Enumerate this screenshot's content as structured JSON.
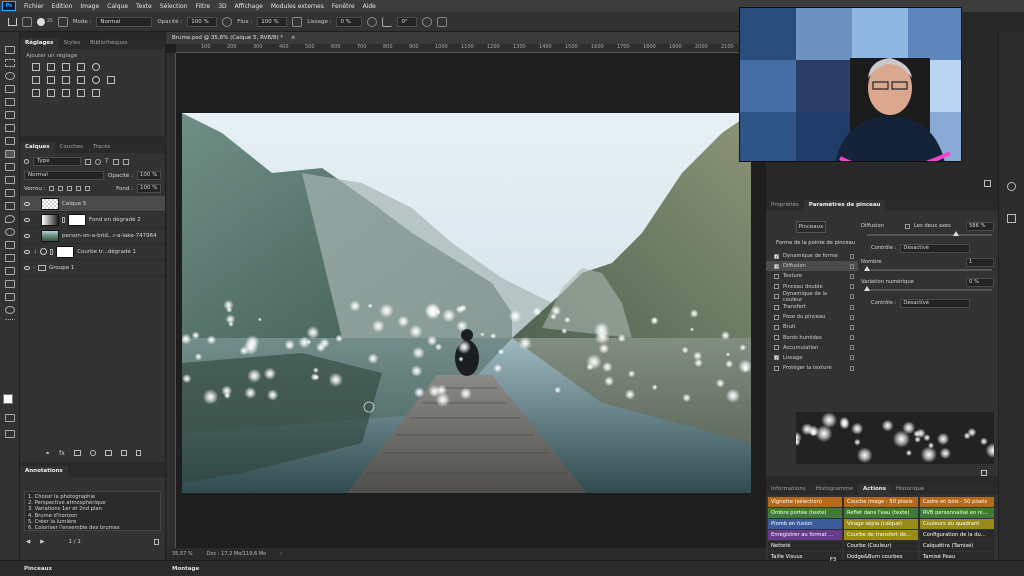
{
  "menubar": {
    "logo": "Ps",
    "items": [
      "Fichier",
      "Edition",
      "Image",
      "Calque",
      "Texte",
      "Sélection",
      "Filtre",
      "3D",
      "Affichage",
      "Modules externes",
      "Fenêtre",
      "Aide"
    ]
  },
  "options": {
    "size": "25",
    "mode_label": "Mode :",
    "mode_value": "Normal",
    "opacity_label": "Opacité :",
    "opacity_value": "100 %",
    "flow_label": "Flux :",
    "flow_value": "100 %",
    "smoothing_label": "Lissage :",
    "smoothing_value": "0 %",
    "angle_value": "0°"
  },
  "adjustments_panel": {
    "tabs": [
      "Réglages",
      "Styles",
      "Bibliothèques"
    ],
    "add_label": "Ajouter un réglage"
  },
  "layers_panel": {
    "tabs": [
      "Calques",
      "Couches",
      "Tracés"
    ],
    "filter_label": "Type",
    "blend_mode": "Normal",
    "opacity_label": "Opacité :",
    "opacity_value": "100 %",
    "lock_label": "Verrou :",
    "fill_label": "Fond :",
    "fill_value": "100 %",
    "layers": [
      {
        "name": "Calque 5",
        "selected": true
      },
      {
        "name": "Fond en dégradé 2",
        "selected": false
      },
      {
        "name": "person-on-a-brid...r-a-lake-747964",
        "selected": false
      },
      {
        "name": "Courbe tr...dégradé 1",
        "selected": false
      },
      {
        "name": "Groupe 1",
        "selected": false
      }
    ]
  },
  "annotations_panel": {
    "title": "Annotations",
    "lines": [
      "1. Choisir la photographie",
      "2. Perspective atmosphérique",
      "3. Variations 1er et 2nd plan",
      "4. Brume d'horizon",
      "5. Créer la lumière",
      "6. Coloriser l'ensemble des brumes"
    ],
    "pager": "1 / 1"
  },
  "bottom_tabs": {
    "left": "Pinceaux",
    "center": "Montage"
  },
  "document": {
    "tab_title": "Brume.psd @ 35,6% (Calque 5, RVB/8) *",
    "ruler_ticks": [
      "100",
      "200",
      "300",
      "400",
      "500",
      "600",
      "700",
      "800",
      "900",
      "1000",
      "1100",
      "1200",
      "1300",
      "1400",
      "1500",
      "1600",
      "1700",
      "1800",
      "1900",
      "2000",
      "2100",
      "2200"
    ],
    "zoom": "35,57 %",
    "doc_info": "Doc : 17,2 Mo/119,6 Mo"
  },
  "properties_panel": {
    "tabs": [
      "Propriétés",
      "Paramètres de pinceau"
    ],
    "brush_button": "Pinceaux",
    "tip_shape": "Forme de la pointe de pinceau",
    "options": [
      {
        "label": "Dynamique de forme",
        "checked": true
      },
      {
        "label": "Diffusion",
        "checked": true
      },
      {
        "label": "Texture",
        "checked": false
      },
      {
        "label": "Pinceau double",
        "checked": false
      },
      {
        "label": "Dynamique de la couleur",
        "checked": false
      },
      {
        "label": "Transfert",
        "checked": false
      },
      {
        "label": "Pose du pinceau",
        "checked": false
      },
      {
        "label": "Bruit",
        "checked": false
      },
      {
        "label": "Bords humides",
        "checked": false
      },
      {
        "label": "Accumulation",
        "checked": false
      },
      {
        "label": "Lissage",
        "checked": true
      },
      {
        "label": "Protéger la texture",
        "checked": false
      }
    ],
    "scatter_label": "Diffusion",
    "both_axes_label": "Les deux axes",
    "scatter_value": "586 %",
    "scatter_level_percent": 71,
    "control_label": "Contrôle :",
    "control_value": "Désactivé",
    "count_label": "Nombre",
    "count_value": "1",
    "count_variation_label": "Variation numérique",
    "count_variation_value": "0 %",
    "control2_label": "Contrôle :",
    "control2_value": "Désactivé"
  },
  "actions_panel": {
    "tabs": [
      "Informations",
      "Histogramme",
      "Actions",
      "Historique"
    ],
    "buttons": [
      {
        "label": "Vignette (sélection)",
        "color": "#b46a1a"
      },
      {
        "label": "Couche image - 50 pixels",
        "color": "#b46a1a"
      },
      {
        "label": "Cadre en bois - 50 pixels",
        "color": "#b46a1a"
      },
      {
        "label": "Ombre portée (texte)",
        "color": "#3f7a3a"
      },
      {
        "label": "Reflet dans l'eau (texte)",
        "color": "#3f7a3a"
      },
      {
        "label": "RVB personnalisé en ni...",
        "color": "#3f7a3a"
      },
      {
        "label": "Plomb en fusion",
        "color": "#3a5a9a"
      },
      {
        "label": "Virage sépia (calque)",
        "color": "#9a8a1a"
      },
      {
        "label": "Couleurs du quadrant",
        "color": "#9a8a1a"
      },
      {
        "label": "Enregistrer au format ...",
        "color": "#6a3a8a"
      },
      {
        "label": "Courbe de transfert de...",
        "color": "#9a8a1a"
      },
      {
        "label": "Configuration de la du...",
        "color": "#2a2a2a"
      },
      {
        "label": "Netteté",
        "color": "#2a2a2a"
      },
      {
        "label": "Courbe (Couleur)",
        "color": "#2a2a2a"
      },
      {
        "label": "Calquétira (Tamisé)",
        "color": "#2a2a2a"
      },
      {
        "label": "Taille Visuus",
        "color": "#2a2a2a"
      },
      {
        "label": "Dodge&Burn courbes",
        "color": "#2a2a2a"
      },
      {
        "label": "Tamisé Peau",
        "color": "#2a2a2a"
      },
      {
        "label": "Info",
        "color": "#2a2a2a"
      },
      {
        "label": "Frequency Separation",
        "color": "#2a2a2a"
      },
      {
        "label": "SF 8bit",
        "color": "#2a2a2a"
      }
    ],
    "shortcut": "F3"
  },
  "colors": {
    "accent": "#31a8ff",
    "panel": "#323232",
    "canvas_bg": "#1e1e1e"
  }
}
